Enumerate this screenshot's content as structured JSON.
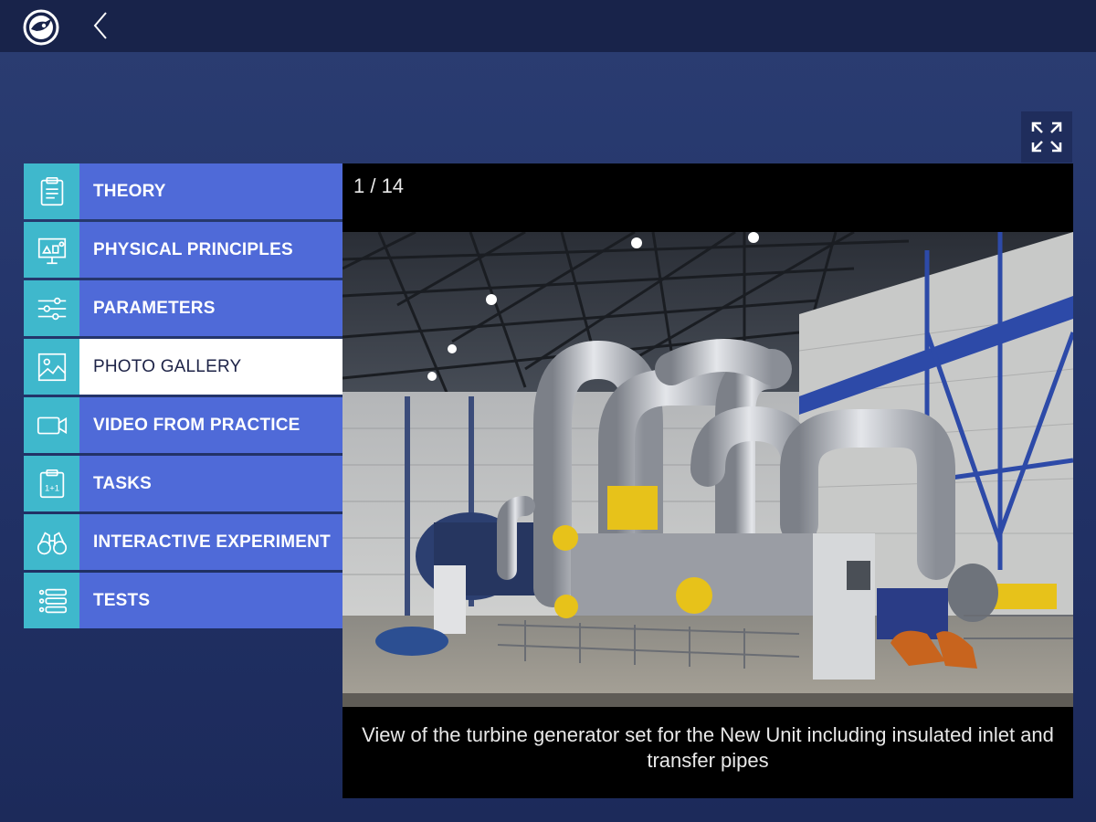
{
  "header": {
    "logo_icon": "skoda-logo-icon",
    "back_icon": "chevron-left-icon"
  },
  "toolbar": {
    "fullscreen_icon": "expand-arrows-icon"
  },
  "menu": {
    "items": [
      {
        "label": "THEORY",
        "icon": "clipboard-text-icon",
        "active": false
      },
      {
        "label": "PHYSICAL PRINCIPLES",
        "icon": "presentation-board-icon",
        "active": false
      },
      {
        "label": "PARAMETERS",
        "icon": "sliders-icon",
        "active": false
      },
      {
        "label": "PHOTO GALLERY",
        "icon": "image-icon",
        "active": true
      },
      {
        "label": "VIDEO FROM PRACTICE",
        "icon": "video-camera-icon",
        "active": false
      },
      {
        "label": "TASKS",
        "icon": "calculator-clipboard-icon",
        "active": false
      },
      {
        "label": "INTERACTIVE EXPERIMENT",
        "icon": "binoculars-icon",
        "active": false
      },
      {
        "label": "TESTS",
        "icon": "checklist-icon",
        "active": false
      }
    ]
  },
  "gallery": {
    "counter": "1 / 14",
    "caption": "View of the turbine generator set for the New Unit including insulated inlet and transfer pipes"
  },
  "colors": {
    "background": "#23346a",
    "topbar": "#18234a",
    "menu_icon_bg": "#3fb8cc",
    "menu_label_bg": "#4f6ad8",
    "active_bg": "#ffffff",
    "active_text": "#1d2347"
  }
}
